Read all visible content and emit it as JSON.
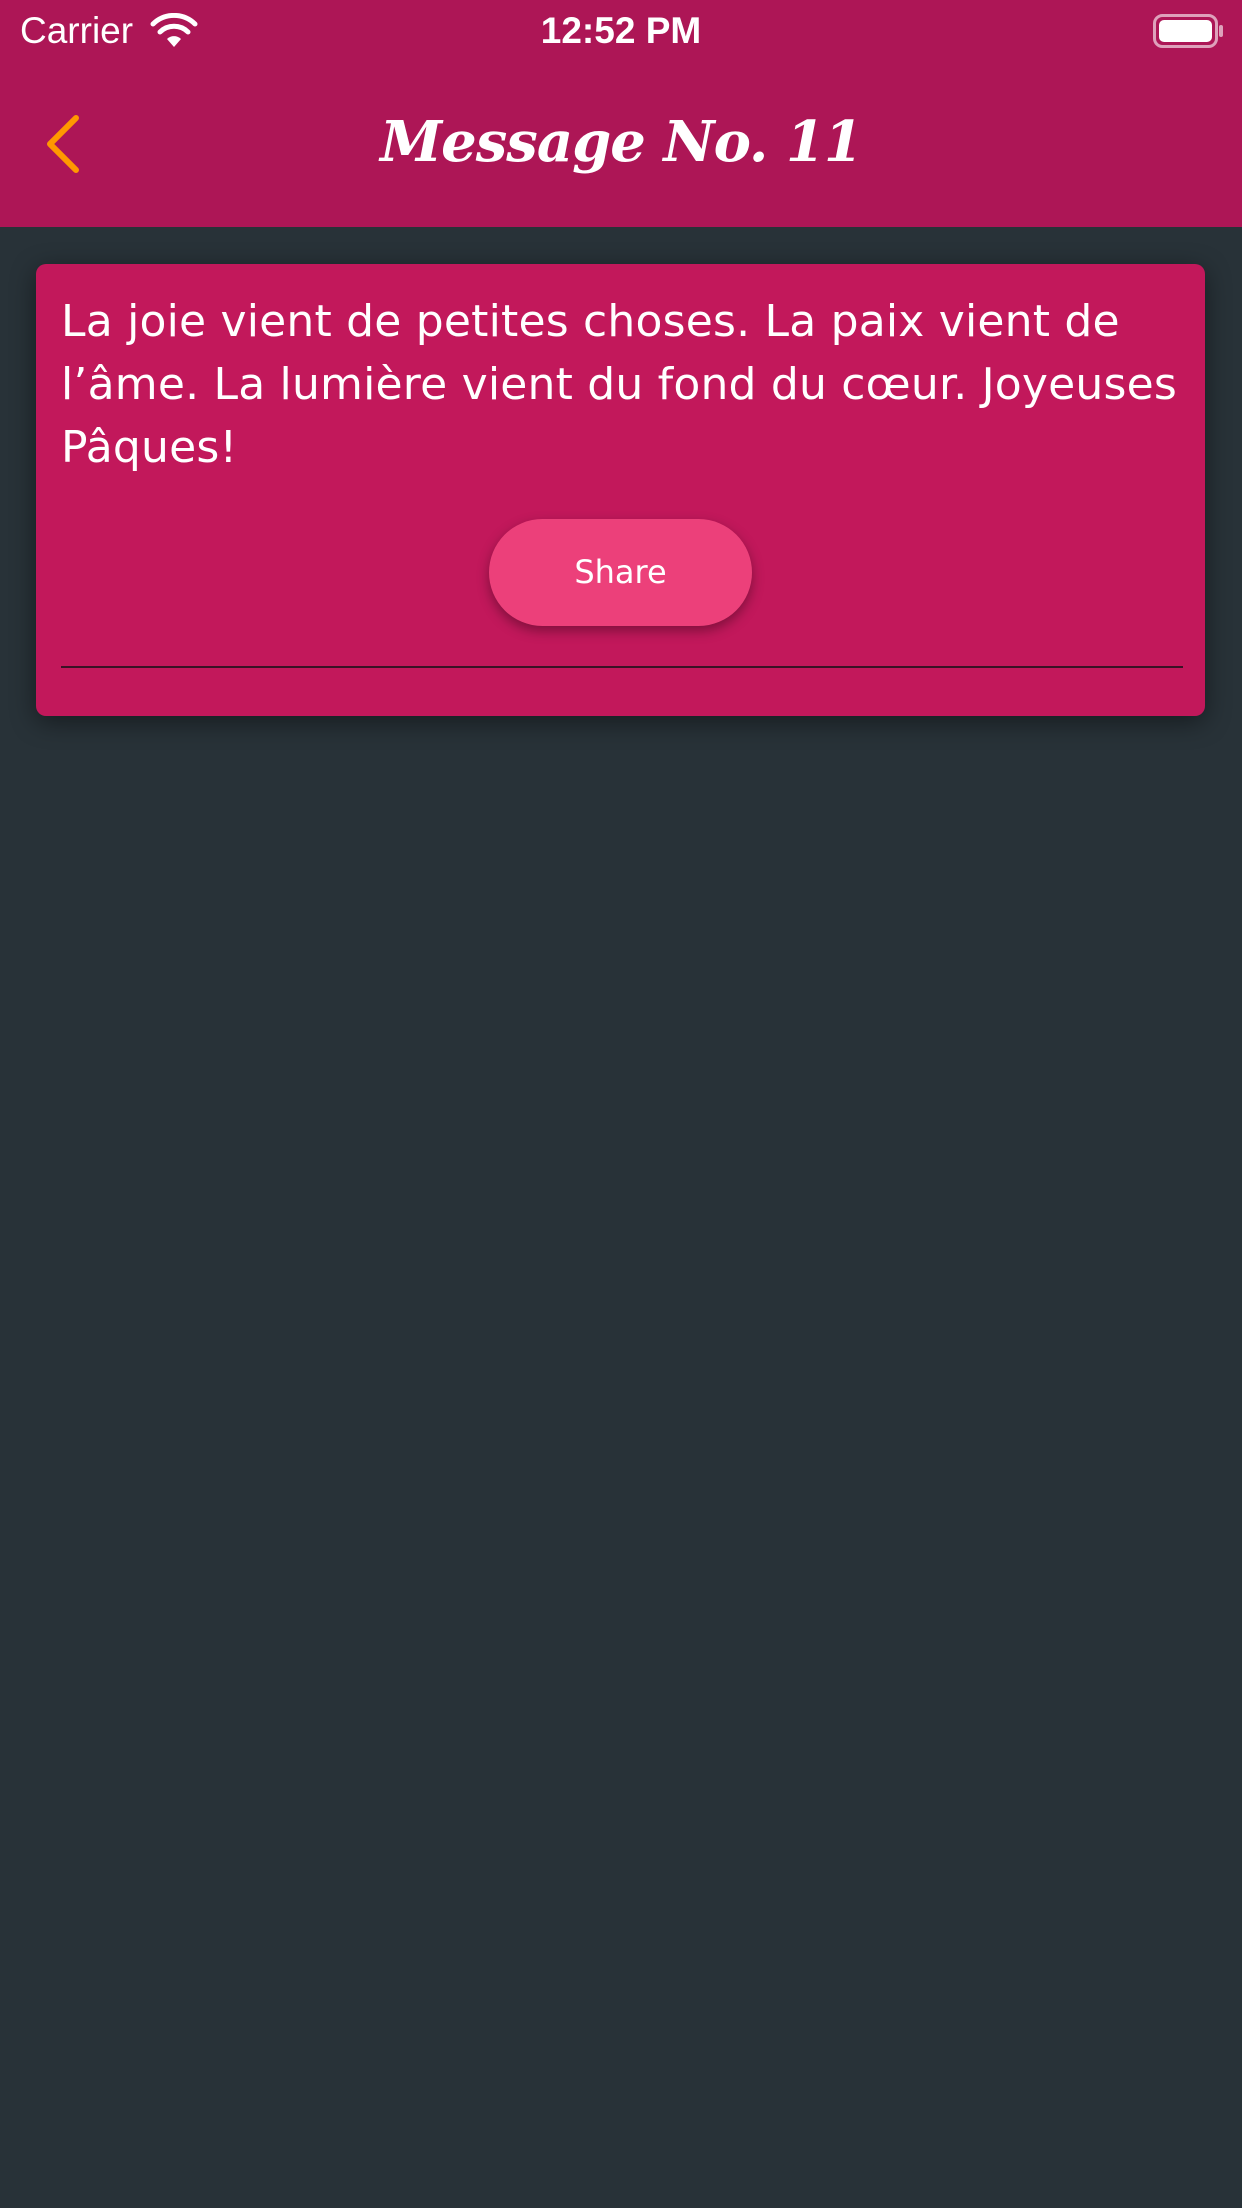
{
  "status_bar": {
    "carrier": "Carrier",
    "time": "12:52 PM",
    "wifi_icon": "wifi-icon",
    "battery_icon": "battery-icon"
  },
  "nav": {
    "back_icon": "chevron-left-icon",
    "title": "Message No. 11"
  },
  "card": {
    "message": "La joie vient de petites choses. La paix vient de l’âme. La lumière vient du fond du cœur. Joyeuses Pâques!",
    "share_label": "Share"
  },
  "colors": {
    "nav_background": "#AD1656",
    "card_background": "#C2185B",
    "share_button": "#EC407A",
    "page_background": "#283238",
    "back_arrow": "#FF9800"
  }
}
